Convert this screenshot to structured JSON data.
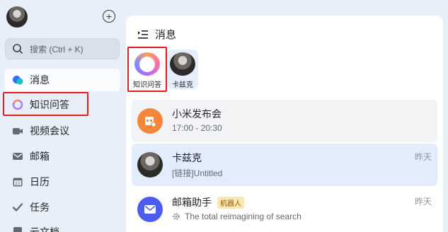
{
  "sidebar": {
    "search_placeholder": "搜索 (Ctrl + K)",
    "items": [
      {
        "label": "消息",
        "icon": "chat-bubble-icon"
      },
      {
        "label": "知识问答",
        "icon": "knowledge-ring-icon"
      },
      {
        "label": "视频会议",
        "icon": "video-camera-icon"
      },
      {
        "label": "邮箱",
        "icon": "mail-icon"
      },
      {
        "label": "日历",
        "icon": "calendar-icon"
      },
      {
        "label": "任务",
        "icon": "check-icon"
      },
      {
        "label": "云文档",
        "icon": "document-icon"
      }
    ],
    "active_index": 0
  },
  "main": {
    "title": "消息",
    "pinned": [
      {
        "label": "知识问答"
      },
      {
        "label": "卡兹克"
      }
    ],
    "chats": [
      {
        "name": "小米发布会",
        "subtitle": "17:00 - 20:30",
        "time": "",
        "avatar": "calendar-event-icon",
        "accent": "#f5873a"
      },
      {
        "name": "卡兹克",
        "subtitle": "[链接]Untitled",
        "time": "昨天",
        "avatar": "user-avatar"
      },
      {
        "name": "邮箱助手",
        "tag": "机器人",
        "subtitle": "The total reimagining of search",
        "time": "昨天",
        "avatar": "mail-icon",
        "accent": "#4d5cf0"
      }
    ]
  },
  "colors": {
    "highlight_red": "#e02020",
    "selected_blue": "#e3ecfb"
  }
}
